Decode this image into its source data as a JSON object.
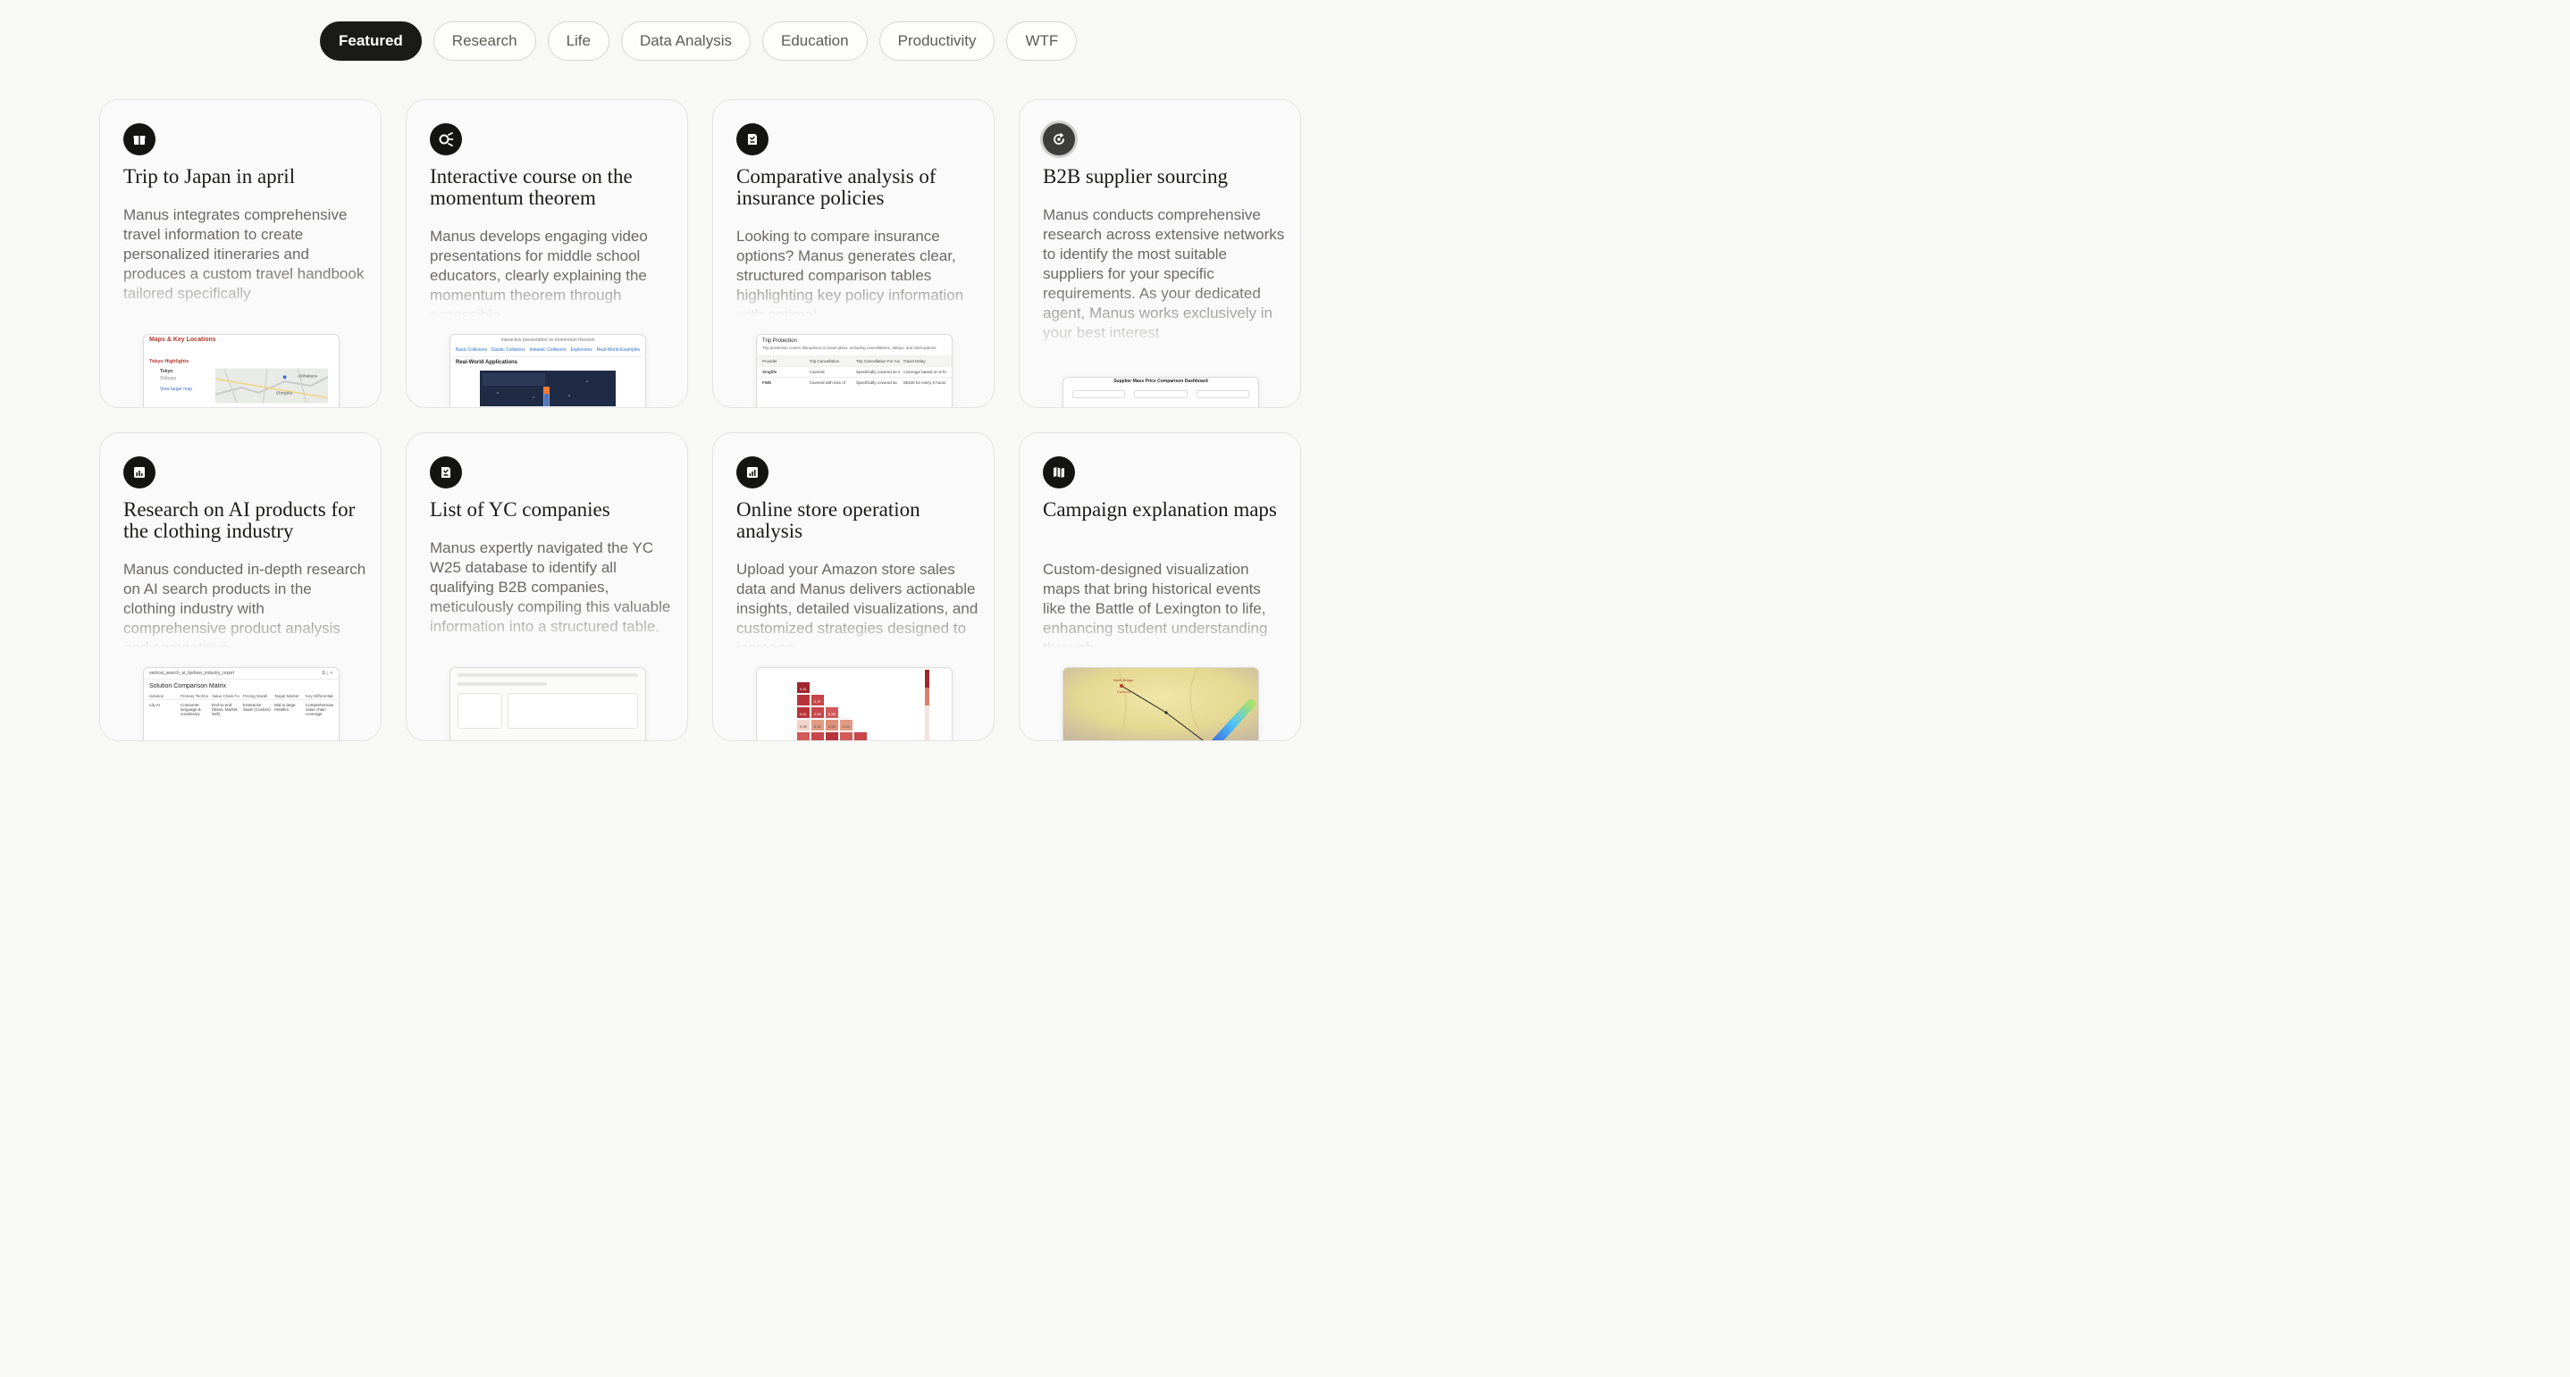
{
  "tabs": [
    {
      "label": "Featured",
      "active": true
    },
    {
      "label": "Research",
      "active": false
    },
    {
      "label": "Life",
      "active": false
    },
    {
      "label": "Data Analysis",
      "active": false
    },
    {
      "label": "Education",
      "active": false
    },
    {
      "label": "Productivity",
      "active": false
    },
    {
      "label": "WTF",
      "active": false
    }
  ],
  "cards": [
    {
      "icon": "gift-icon",
      "title": "Trip to Japan in april",
      "description": "Manus integrates comprehensive travel information to create personalized itineraries and produces a custom travel handbook tailored specifically",
      "preview": {
        "heading": "Maps & Key Locations",
        "subheading": "Tokyo Highlights",
        "lines": [
          "Tokyo",
          "Shibuya",
          "Shinjuku",
          "Akihabara",
          "View larger map"
        ]
      }
    },
    {
      "icon": "sparkle-icon",
      "title": "Interactive course on the momentum theorem",
      "description": "Manus develops engaging video presentations for middle school educators, clearly explaining the momentum theorem through accessible",
      "preview": {
        "heading": "Interactive presentation on momentum theorem",
        "subheading": "Real-World Applications",
        "lines": [
          "Basic Collisions",
          "Elastic Collisions",
          "Inelastic Collisions",
          "Explosions",
          "Real-World Examples"
        ]
      }
    },
    {
      "icon": "document-icon",
      "title": "Comparative analysis of insurance policies",
      "description": "Looking to compare insurance options? Manus generates clear, structured comparison tables highlighting key policy information with optimal",
      "preview": {
        "heading": "Trip Protection",
        "subheading": "Trip protection covers disruptions to travel plans, including cancellations, delays, and interruptions.",
        "lines": [
          "Provider",
          "Trip Cancellation",
          "Trip Cancellation For Any Reason",
          "Travel Delay",
          "Singlife",
          "Covered",
          "Specifically covered as separate benefit",
          "Coverage based on 6-hour delay increments",
          "FWD",
          "Covered with loss of",
          "Specifically covered as",
          "S$100 for every 6 hours delay"
        ]
      }
    },
    {
      "icon": "refresh-icon",
      "title": "B2B supplier sourcing",
      "description": "Manus conducts comprehensive research across extensive networks to identify the most suitable suppliers for your specific requirements. As your dedicated agent, Manus works exclusively in your best interest",
      "preview": {
        "heading": "Supplier Mass Price Comparison Dashboard",
        "subheading": "",
        "lines": []
      }
    },
    {
      "icon": "chart-icon",
      "title": "Research on AI products for the clothing industry",
      "description": "Manus conducted in-depth research on AI search products in the clothing industry with comprehensive product analysis and competitive",
      "preview": {
        "heading": "vertical_search_ai_fashion_industry_report",
        "subheading": "Solution Comparison Matrix",
        "lines": [
          "Solution",
          "Primary Technology",
          "Value Chain Focus",
          "Pricing Model",
          "Target Market",
          "Key Differentiator",
          "Lily AI",
          "Consumer language & vocabulary",
          "End-to-end (Mass, Market, Sell)",
          "Enterprise SaaS (Custom)",
          "Mid to large retailers",
          "Comprehensive value chain coverage"
        ]
      }
    },
    {
      "icon": "document-icon",
      "title": "List of YC companies",
      "description": "Manus expertly navigated the YC W25 database to identify all qualifying B2B companies, meticulously compiling this valuable information into a structured table.",
      "preview": {
        "heading": "",
        "subheading": "",
        "lines": []
      }
    },
    {
      "icon": "bar-chart-icon",
      "title": "Online store operation analysis",
      "description": "Upload your Amazon store sales data and Manus delivers actionable insights, detailed visualizations, and customized strategies designed to increase",
      "preview": {
        "heading": "",
        "subheading": "",
        "lines": [
          "0.81",
          "0.37",
          "0.61",
          "0.55",
          "0.51",
          "0.56",
          "0.05",
          "0.24",
          "0.32",
          "0.24"
        ]
      }
    },
    {
      "icon": "map-icon",
      "title": "Campaign explanation maps",
      "description": "Custom-designed visualization maps that bring historical events like the Battle of Lexington to life, enhancing student understanding through",
      "preview": {
        "heading": "",
        "subheading": "",
        "lines": [
          "North Bridge",
          "Concord"
        ]
      }
    }
  ]
}
